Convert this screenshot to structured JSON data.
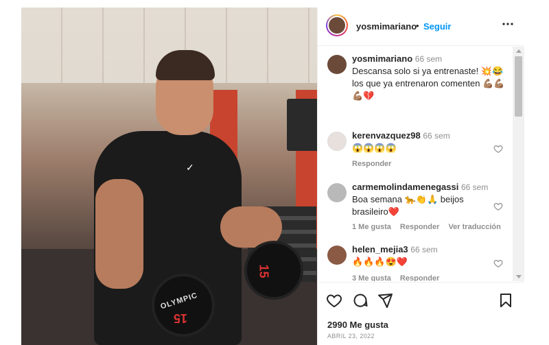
{
  "post": {
    "image_caption_visible": {
      "dumbbell_brand": "OLYMPIC",
      "dumbbell_weight": "15"
    }
  },
  "header": {
    "username": "yosmimariano",
    "separator": "•",
    "follow_label": "Seguir",
    "more_icon": "more-options-icon"
  },
  "caption": {
    "username": "yosmimariano",
    "time": "66 sem",
    "line1": "Descansa solo si ya entrenaste! 💥😂",
    "line2": "los que ya entrenaron comenten 💪🏽💪🏽",
    "line3": "💪🏽💔"
  },
  "comments": [
    {
      "username": "kerenvazquez98",
      "time": "66 sem",
      "text": "😱😱😱😱",
      "actions": [
        "Responder"
      ]
    },
    {
      "username": "carmemolindamenegassi",
      "time": "66 sem",
      "text_line1": "Boa semana 🐆👏🙏 beijos",
      "text_line2": "brasileiro❤️",
      "actions": [
        "1 Me gusta",
        "Responder",
        "Ver traducción"
      ]
    },
    {
      "username": "helen_mejia3",
      "time": "66 sem",
      "text": "🔥🔥🔥😍❤️",
      "actions": [
        "3 Me gusta",
        "Responder"
      ]
    }
  ],
  "footer": {
    "likes": "2990 Me gusta",
    "date": "ABRIL 23, 2022"
  },
  "colors": {
    "link_blue": "#0095f6",
    "text": "#262626",
    "muted": "#8e8e8e",
    "border": "#efefef"
  }
}
